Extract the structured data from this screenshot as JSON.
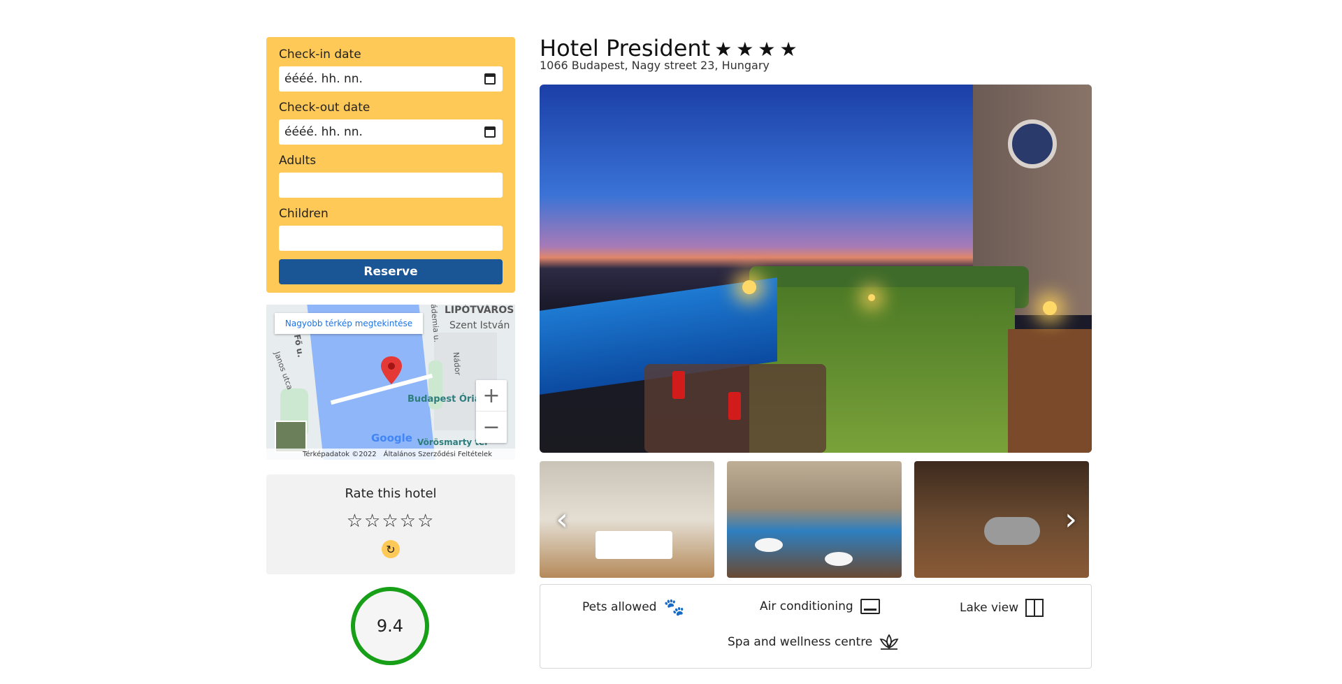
{
  "booking": {
    "checkin_label": "Check-in date",
    "checkin_placeholder": "éééé. hh. nn.",
    "checkout_label": "Check-out date",
    "checkout_placeholder": "éééé. hh. nn.",
    "adults_label": "Adults",
    "adults_value": "",
    "children_label": "Children",
    "children_value": "",
    "reserve_label": "Reserve"
  },
  "map": {
    "larger_map_link": "Nagyobb térkép megtekintése",
    "labels": {
      "district": "LIPÓTVÁROS",
      "szent_istvan": "Szent István",
      "budapest_oria": "Budapest Óriá",
      "vorosmarty": "Vörösmarty tér",
      "fo_u": "Fő u.",
      "nador": "Nádor",
      "janos": "Janos utca",
      "akademia": "ádemia u."
    },
    "zoom_in": "+",
    "zoom_out": "−",
    "google": "Google",
    "attribution_data": "Térképadatok ©2022",
    "attribution_terms": "Általános Szerződési Feltételek"
  },
  "rating": {
    "title": "Rate this hotel",
    "stars": "☆☆☆☆☆",
    "reset_icon": "↻",
    "score": "9.4",
    "score_value": 9.4,
    "score_color": "#17a017"
  },
  "hotel": {
    "name": "Hotel President",
    "stars": "★★★★",
    "star_count": 4,
    "address": "1066 Budapest, Nagy street 23, Hungary"
  },
  "carousel": {
    "prev_icon": "‹",
    "next_icon": "›"
  },
  "amenities": [
    {
      "label": "Pets allowed",
      "icon": "paw-icon"
    },
    {
      "label": "Air conditioning",
      "icon": "air-conditioner-icon"
    },
    {
      "label": "Lake view",
      "icon": "window-view-icon"
    },
    {
      "label": "Spa and wellness centre",
      "icon": "lotus-icon"
    }
  ],
  "colors": {
    "booking_bg": "#fec956",
    "reserve_bg": "#1a5596",
    "rate_bg": "#f2f2f2"
  }
}
